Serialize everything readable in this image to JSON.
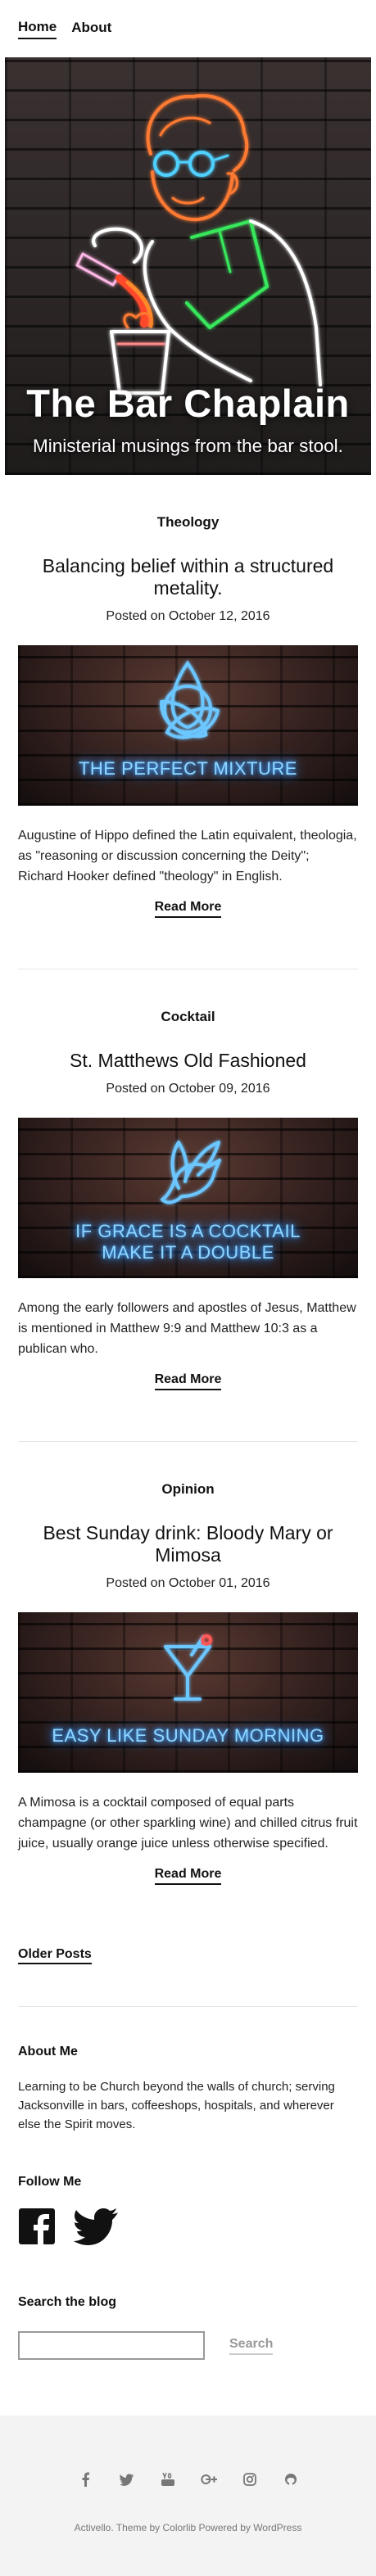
{
  "nav": {
    "items": [
      "Home",
      "About"
    ]
  },
  "hero": {
    "title": "The Bar Chaplain",
    "subtitle": "Ministerial musings from the bar stool."
  },
  "posts": [
    {
      "category": "Theology",
      "title": "Balancing belief within a structured metality.",
      "date": "Posted on October 12, 2016",
      "image_text": "THE PERFECT MIXTURE",
      "image_icon": "trinity-knot-icon",
      "excerpt": "Augustine of Hippo defined the Latin equivalent, theologia, as \"reasoning or discussion concerning the Deity\"; Richard Hooker defined \"theology\" in English.",
      "read_more": "Read More"
    },
    {
      "category": "Cocktail",
      "title": "St. Matthews Old Fashioned",
      "date": "Posted on October 09, 2016",
      "image_text_line1": "IF GRACE IS A COCKTAIL",
      "image_text_line2": "MAKE IT A DOUBLE",
      "image_icon": "dove-icon",
      "excerpt": "Among the early followers and apostles of Jesus, Matthew is mentioned in Matthew 9:9 and Matthew 10:3 as a publican who.",
      "read_more": "Read More"
    },
    {
      "category": "Opinion",
      "title": "Best Sunday drink: Bloody Mary or Mimosa",
      "date": "Posted on October 01, 2016",
      "image_text": "EASY LIKE SUNDAY MORNING",
      "image_icon": "cocktail-glass-icon",
      "excerpt": "A Mimosa is a cocktail composed of equal parts champagne (or other sparkling wine) and chilled citrus fruit juice, usually orange juice unless otherwise specified.",
      "read_more": "Read More"
    }
  ],
  "older_posts": "Older Posts",
  "about": {
    "heading": "About Me",
    "text": "Learning to be Church beyond the walls of church; serving Jacksonville in bars, coffeeshops, hospitals, and wherever else the Spirit moves."
  },
  "follow": {
    "heading": "Follow Me",
    "icons": [
      "facebook-icon",
      "twitter-icon"
    ]
  },
  "search": {
    "heading": "Search the blog",
    "button": "Search",
    "value": ""
  },
  "footer": {
    "social_icons": [
      "facebook-icon",
      "twitter-icon",
      "youtube-icon",
      "google-plus-icon",
      "instagram-icon",
      "github-icon"
    ],
    "credits": "Activello. Theme by Colorlib Powered by WordPress"
  },
  "colors": {
    "neon_blue": "#8fd6ff",
    "footer_bg": "#f3f3f3"
  }
}
